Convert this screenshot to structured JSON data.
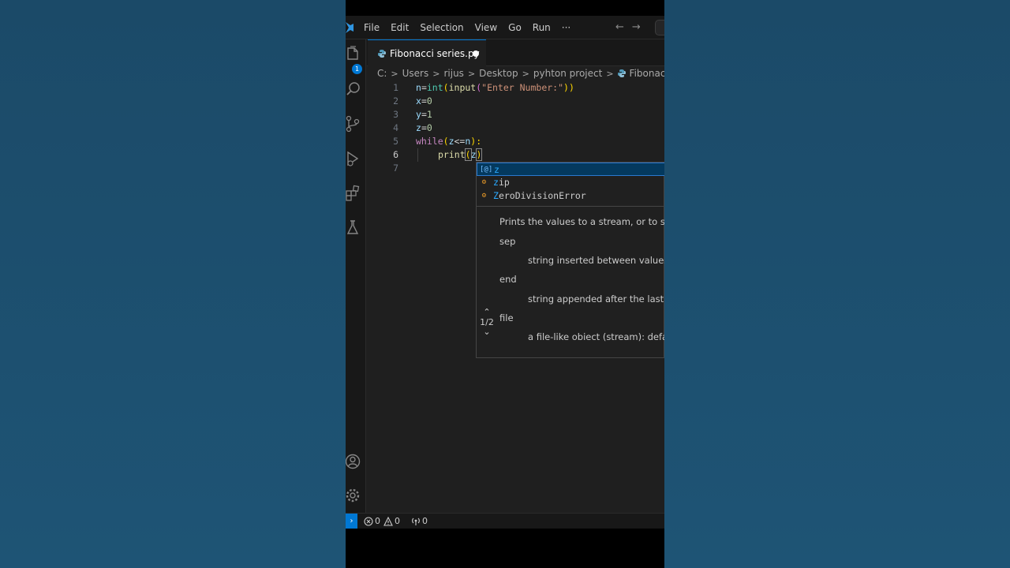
{
  "menu": [
    "File",
    "Edit",
    "Selection",
    "View",
    "Go",
    "Run",
    "···"
  ],
  "explorer_badge": "1",
  "tab": {
    "label": "Fibonacci series.py"
  },
  "breadcrumb": [
    "C:",
    "Users",
    "rijus",
    "Desktop",
    "pyhton project",
    "Fibonacci series.py"
  ],
  "editor": {
    "line_numbers": [
      "1",
      "2",
      "3",
      "4",
      "5",
      "6",
      "7"
    ],
    "lines": {
      "l1": {
        "v": "n",
        "eq": "=",
        "f1": "int",
        "lp": "(",
        "f2": "input",
        "lp2": "(",
        "s": "\"Enter Number:\"",
        "rp": "))"
      },
      "l2": {
        "v": "x",
        "eq": "=",
        "n": "0"
      },
      "l3": {
        "v": "y",
        "eq": "=",
        "n": "1"
      },
      "l4": {
        "v": "z",
        "eq": "=",
        "n": "0"
      },
      "l5": {
        "kw": "while",
        "lp": "(",
        "a": "z",
        "op": "<=",
        "b": "n",
        "rp": "):"
      },
      "l6": {
        "f": "print",
        "lp": "(",
        "a": "z",
        "rp": ")"
      }
    }
  },
  "suggest": [
    {
      "match": "z",
      "rest": "",
      "kind": "variable"
    },
    {
      "match": "z",
      "rest": "ip",
      "kind": "class"
    },
    {
      "match": "Z",
      "rest": "eroDivisionError",
      "kind": "class"
    }
  ],
  "sighelp": {
    "description": "Prints the values to a stream, or to sys",
    "params": [
      {
        "name": "sep",
        "desc": "string inserted between values,"
      },
      {
        "name": "end",
        "desc": "string appended after the last v"
      },
      {
        "name": "file",
        "desc": "a file-like obiect (stream): defau"
      }
    ],
    "page": "1/2"
  },
  "status": {
    "errors": "0",
    "warnings": "0",
    "ports": "0"
  },
  "colors": {
    "accent": "#0078d4",
    "background": "#1f1f1f",
    "page_bg": "#1d4f6e"
  }
}
